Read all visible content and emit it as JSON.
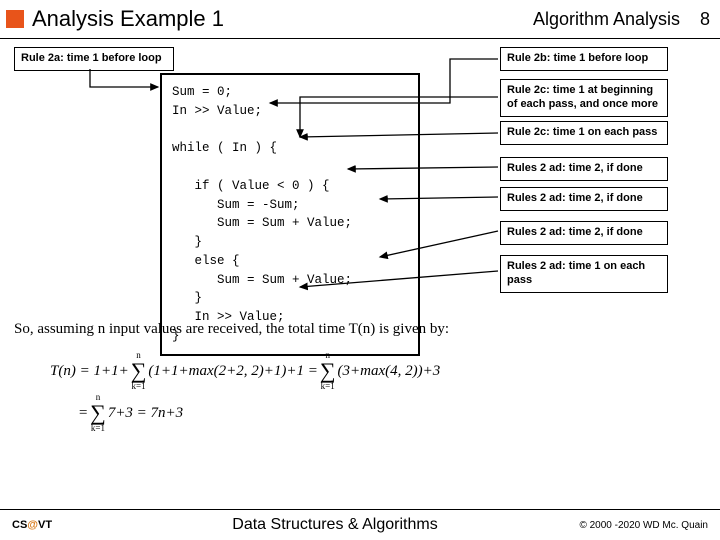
{
  "header": {
    "title": "Analysis Example 1",
    "right": "Algorithm Analysis",
    "page": "8"
  },
  "rules": {
    "r2a": "Rule 2a: time 1 before loop",
    "r2b": "Rule 2b: time 1 before loop",
    "r2c1": "Rule 2c: time 1 at beginning of each pass, and once more",
    "r2c2": "Rule 2c: time 1 on each pass",
    "r2ad1": "Rules 2 ad: time 2, if done",
    "r2ad2": "Rules 2 ad: time 2, if done",
    "r2ad3": "Rules 2 ad: time 2, if done",
    "r2ad4": "Rules 2 ad: time 1 on each pass"
  },
  "code": "Sum = 0;\nIn >> Value;\n\nwhile ( In ) {\n\n   if ( Value < 0 ) {\n      Sum = -Sum;\n      Sum = Sum + Value;\n   }\n   else {\n      Sum = Sum + Value;\n   }\n   In >> Value;\n}",
  "summary": "So, assuming n input values are received, the total time T(n) is given by:",
  "eq": {
    "lhs": "T(n) = 1+1+",
    "mid1": "(1+1+max(2+2, 2)+1)+1 = ",
    "mid2": "(3+max(4, 2))+3",
    "line2a": "= ",
    "line2b": "7+3 = 7n+3",
    "sigma_top": "n",
    "sigma_bot": "k=1"
  },
  "footer": {
    "left_pre": "CS",
    "left_at": "@",
    "left_post": "VT",
    "center": "Data Structures & Algorithms",
    "right": "© 2000 -2020 WD Mc. Quain"
  }
}
